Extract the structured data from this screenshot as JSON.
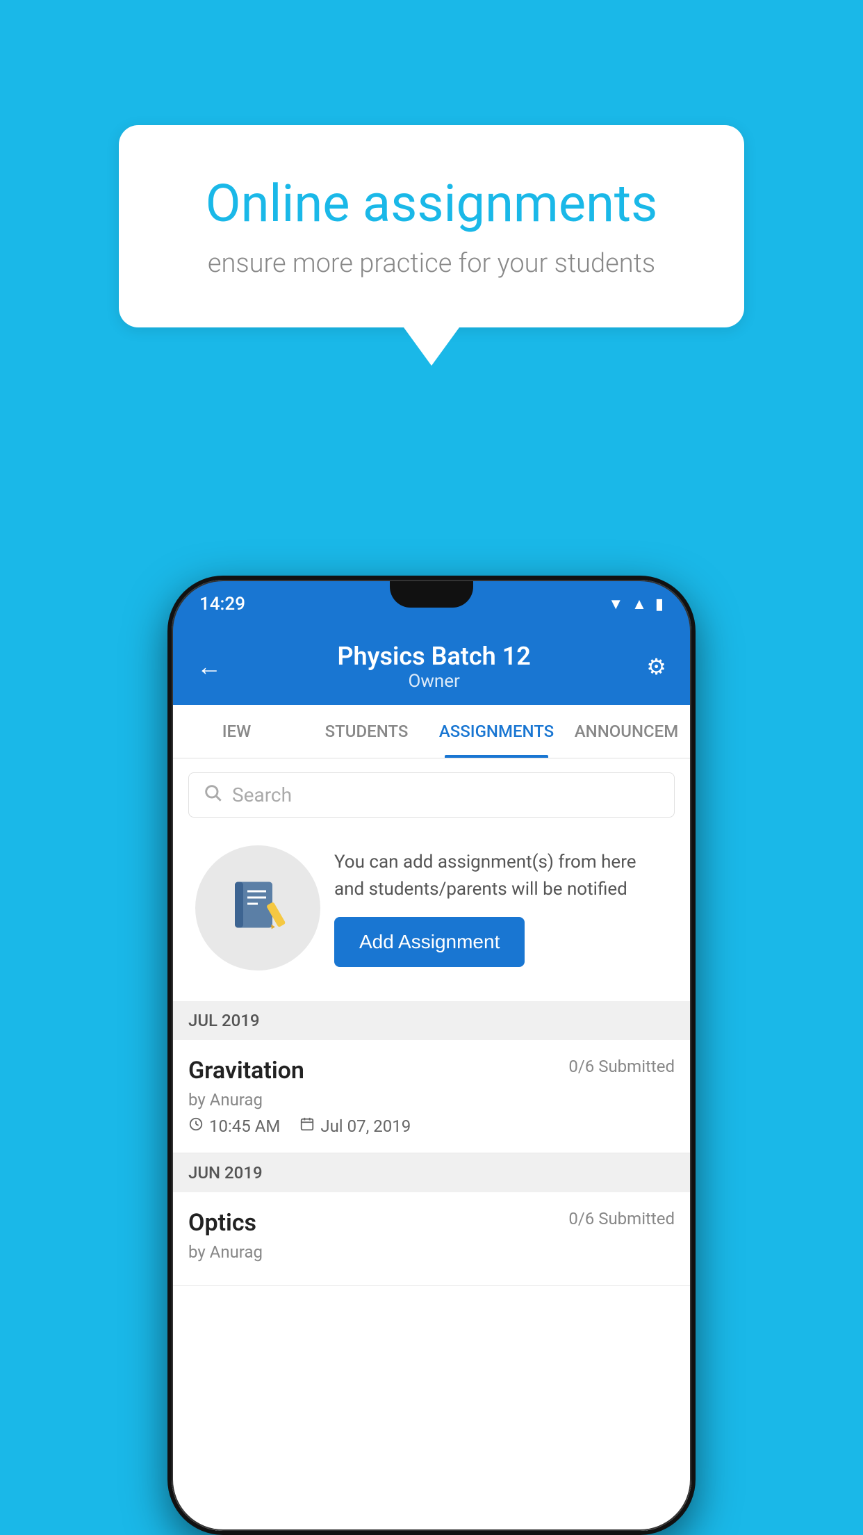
{
  "background_color": "#1ab8e8",
  "speech_bubble": {
    "title": "Online assignments",
    "subtitle": "ensure more practice for your students"
  },
  "phone": {
    "status_bar": {
      "time": "14:29",
      "icons": [
        "wifi",
        "signal",
        "battery"
      ]
    },
    "app_bar": {
      "title": "Physics Batch 12",
      "subtitle": "Owner",
      "back_label": "←",
      "settings_label": "⚙"
    },
    "tabs": [
      {
        "label": "IEW",
        "active": false
      },
      {
        "label": "STUDENTS",
        "active": false
      },
      {
        "label": "ASSIGNMENTS",
        "active": true
      },
      {
        "label": "ANNOUNCEM",
        "active": false
      }
    ],
    "search": {
      "placeholder": "Search"
    },
    "empty_state": {
      "description": "You can add assignment(s) from here and students/parents will be notified",
      "button_label": "Add Assignment"
    },
    "sections": [
      {
        "header": "JUL 2019",
        "assignments": [
          {
            "name": "Gravitation",
            "submitted": "0/6 Submitted",
            "by": "by Anurag",
            "time": "10:45 AM",
            "date": "Jul 07, 2019"
          }
        ]
      },
      {
        "header": "JUN 2019",
        "assignments": [
          {
            "name": "Optics",
            "submitted": "0/6 Submitted",
            "by": "by Anurag",
            "time": "",
            "date": ""
          }
        ]
      }
    ]
  }
}
